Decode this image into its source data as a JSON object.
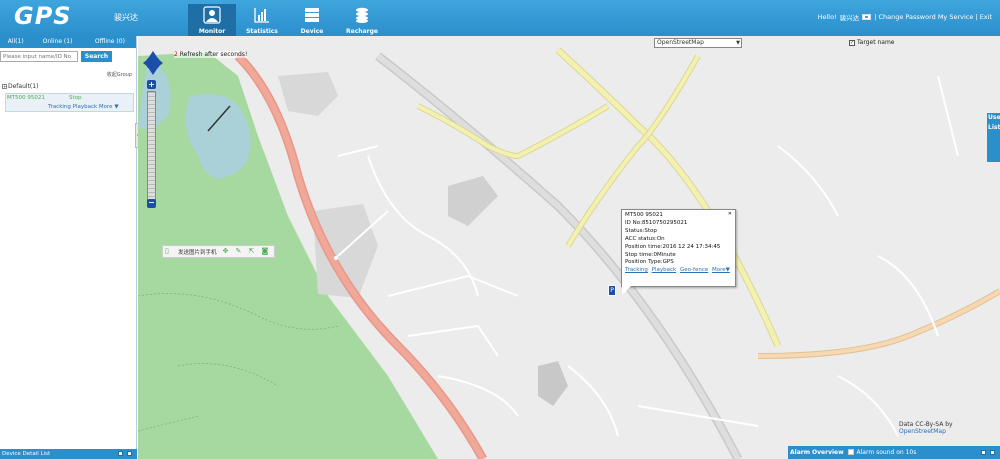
{
  "header": {
    "logo": "GPS",
    "company": "骏兴达",
    "nav": [
      {
        "label": "Monitor",
        "icon": "person-icon",
        "active": true
      },
      {
        "label": "Statistics",
        "icon": "chart-icon",
        "active": false
      },
      {
        "label": "Device",
        "icon": "server-icon",
        "active": false
      },
      {
        "label": "Recharge",
        "icon": "coins-icon",
        "active": false
      }
    ],
    "user": {
      "hello": "Hello!",
      "name": "骏兴达",
      "links": "| Change Password  My Service | Exit"
    }
  },
  "sidebar": {
    "tabs": [
      "All(1)",
      "Online (1)",
      "Offline (0)"
    ],
    "search": {
      "placeholder": "Please input name/ID No",
      "button": "Search"
    },
    "collapse": "收起Group",
    "group": "Default(1)",
    "device": {
      "name": "MT500 95021",
      "status": "Stop",
      "links": "Tracking Playback More ▼"
    },
    "footer": "Device Detail List"
  },
  "map": {
    "type": "OpenStreetMap",
    "target_name": "Target name",
    "refresh_num": "2",
    "refresh_text": "Refresh after seconds!",
    "toolbar_label": "发送图片到手机",
    "popup": {
      "title": "MT500 95021",
      "id": "ID No:8510750295021",
      "status": "Status:Stop",
      "acc": "ACC status:On",
      "time": "Position time:2016 12 24 17:34:45",
      "stop": "Stop time:0Minute",
      "ptype": "Position Type:GPS",
      "links": [
        "Tracking",
        "Playback",
        "Geo-fence",
        "More▼"
      ]
    },
    "marker": "P",
    "right_tab": "Use List",
    "copyright_prefix": "Data CC-By-SA by",
    "copyright_link": "OpenStreetMap",
    "alarm": {
      "title": "Alarm Overview",
      "sound": "Alarm sound on 10s"
    }
  }
}
